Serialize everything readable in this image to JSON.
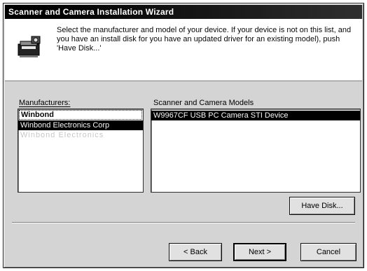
{
  "window": {
    "title": "Scanner and Camera Installation Wizard"
  },
  "header": {
    "icon": "scanner-camera-icon",
    "instruction": "Select the manufacturer and model of your device. If your device is not on this list, and you have an install disk for you have an updated driver for an existing model), push 'Have Disk...'"
  },
  "manufacturers": {
    "label": "Manufacturers:",
    "items": [
      "Winbond",
      "Winbond Electronics Corp",
      "Winbond Electronics"
    ],
    "selected": "Winbond"
  },
  "models": {
    "label": "Scanner and Camera Models",
    "items": [
      "W9967CF USB PC Camera STI Device"
    ]
  },
  "buttons": {
    "have_disk": "Have Disk...",
    "back": "< Back",
    "next": "Next >",
    "cancel": "Cancel"
  },
  "colors": {
    "selection": "#0d0d0d",
    "titlebar": "#0c0c0c"
  }
}
